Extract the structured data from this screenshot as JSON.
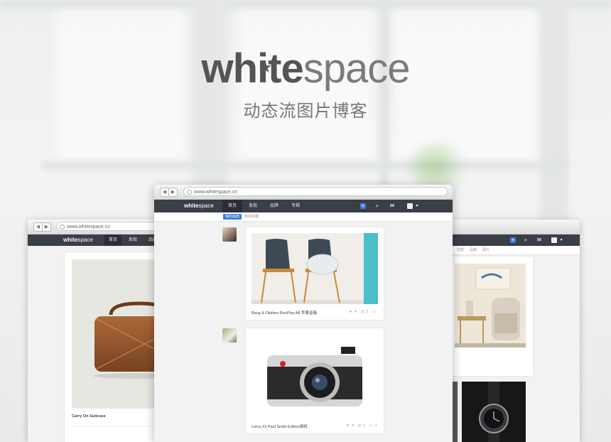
{
  "brand": {
    "logo_bold": "white",
    "logo_light": "space",
    "tagline": "动态流图片博客"
  },
  "browser": {
    "url": "www.whitespace.cn"
  },
  "nav": {
    "logo_bold": "white",
    "logo_light": "space",
    "tabs": [
      "首页",
      "发现",
      "品牌",
      "专辑"
    ]
  },
  "subtabs": [
    "我的动态",
    "我的收藏"
  ],
  "posts": [
    {
      "caption": "Bang & Olufsen BeoPlay A8 苹果音箱",
      "likes": "4",
      "reposts": "2"
    },
    {
      "caption": "Leica X2 Paul Smith Edition相机",
      "likes": "4",
      "reposts": "1",
      "comments": "2"
    }
  ],
  "left_post": {
    "caption": "Carry On Suitcase"
  },
  "right_subtabs": [
    "标签",
    "品牌",
    "图片"
  ],
  "colors": {
    "topbar": "#3a3e46",
    "accent": "#3d7bd8",
    "text": "#545454"
  }
}
